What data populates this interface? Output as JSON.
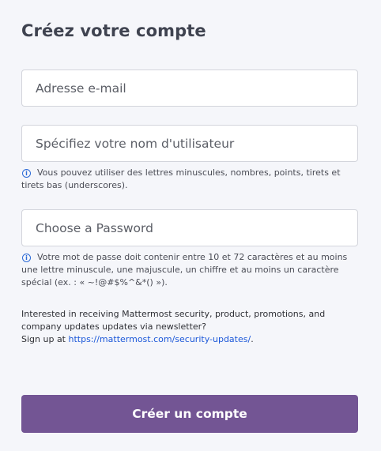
{
  "form": {
    "title": "Créez votre compte",
    "email": {
      "placeholder": "Adresse e-mail",
      "value": ""
    },
    "username": {
      "placeholder": "Spécifiez votre nom d'utilisateur",
      "value": "",
      "hint": "Vous pouvez utiliser des lettres minuscules, nombres, points, tirets et tirets bas (underscores)."
    },
    "password": {
      "placeholder": "Choose a Password",
      "value": "",
      "hint": "Votre mot de passe doit contenir entre 10 et 72 caractères et au moins une lettre minuscule, une majuscule, un chiffre et au moins un caractère spécial (ex. : « ~!@#$%^&*() »)."
    },
    "newsletter": {
      "text": "Interested in receiving Mattermost security, product, promotions, and company updates updates via newsletter?",
      "signup_prefix": "Sign up at ",
      "link_text": "https://mattermost.com/security-updates/",
      "signup_suffix": "."
    },
    "submit_label": "Créer un compte"
  },
  "icons": {
    "info": "info-circle-icon"
  },
  "colors": {
    "accent_button": "#735594",
    "link": "#1c58d9",
    "info_icon": "#2d6bd7",
    "background": "#f5f6fa"
  }
}
